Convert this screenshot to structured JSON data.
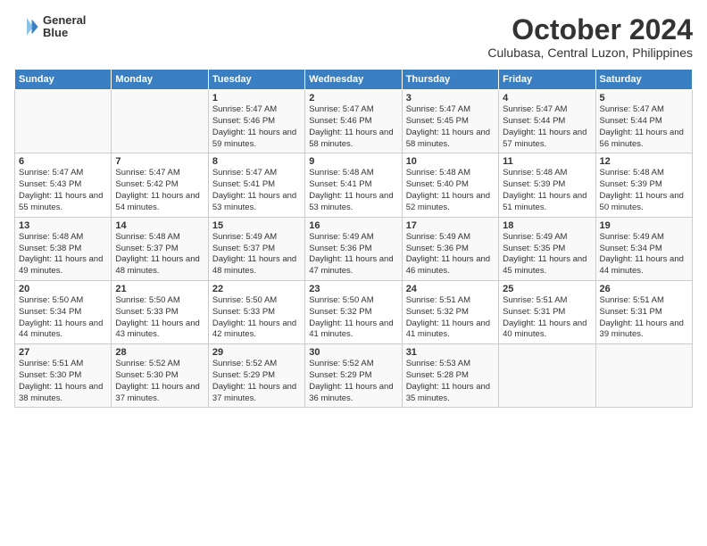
{
  "logo": {
    "line1": "General",
    "line2": "Blue"
  },
  "title": "October 2024",
  "subtitle": "Culubasa, Central Luzon, Philippines",
  "days_of_week": [
    "Sunday",
    "Monday",
    "Tuesday",
    "Wednesday",
    "Thursday",
    "Friday",
    "Saturday"
  ],
  "weeks": [
    [
      {
        "num": "",
        "sunrise": "",
        "sunset": "",
        "daylight": ""
      },
      {
        "num": "",
        "sunrise": "",
        "sunset": "",
        "daylight": ""
      },
      {
        "num": "1",
        "sunrise": "Sunrise: 5:47 AM",
        "sunset": "Sunset: 5:46 PM",
        "daylight": "Daylight: 11 hours and 59 minutes."
      },
      {
        "num": "2",
        "sunrise": "Sunrise: 5:47 AM",
        "sunset": "Sunset: 5:46 PM",
        "daylight": "Daylight: 11 hours and 58 minutes."
      },
      {
        "num": "3",
        "sunrise": "Sunrise: 5:47 AM",
        "sunset": "Sunset: 5:45 PM",
        "daylight": "Daylight: 11 hours and 58 minutes."
      },
      {
        "num": "4",
        "sunrise": "Sunrise: 5:47 AM",
        "sunset": "Sunset: 5:44 PM",
        "daylight": "Daylight: 11 hours and 57 minutes."
      },
      {
        "num": "5",
        "sunrise": "Sunrise: 5:47 AM",
        "sunset": "Sunset: 5:44 PM",
        "daylight": "Daylight: 11 hours and 56 minutes."
      }
    ],
    [
      {
        "num": "6",
        "sunrise": "Sunrise: 5:47 AM",
        "sunset": "Sunset: 5:43 PM",
        "daylight": "Daylight: 11 hours and 55 minutes."
      },
      {
        "num": "7",
        "sunrise": "Sunrise: 5:47 AM",
        "sunset": "Sunset: 5:42 PM",
        "daylight": "Daylight: 11 hours and 54 minutes."
      },
      {
        "num": "8",
        "sunrise": "Sunrise: 5:47 AM",
        "sunset": "Sunset: 5:41 PM",
        "daylight": "Daylight: 11 hours and 53 minutes."
      },
      {
        "num": "9",
        "sunrise": "Sunrise: 5:48 AM",
        "sunset": "Sunset: 5:41 PM",
        "daylight": "Daylight: 11 hours and 53 minutes."
      },
      {
        "num": "10",
        "sunrise": "Sunrise: 5:48 AM",
        "sunset": "Sunset: 5:40 PM",
        "daylight": "Daylight: 11 hours and 52 minutes."
      },
      {
        "num": "11",
        "sunrise": "Sunrise: 5:48 AM",
        "sunset": "Sunset: 5:39 PM",
        "daylight": "Daylight: 11 hours and 51 minutes."
      },
      {
        "num": "12",
        "sunrise": "Sunrise: 5:48 AM",
        "sunset": "Sunset: 5:39 PM",
        "daylight": "Daylight: 11 hours and 50 minutes."
      }
    ],
    [
      {
        "num": "13",
        "sunrise": "Sunrise: 5:48 AM",
        "sunset": "Sunset: 5:38 PM",
        "daylight": "Daylight: 11 hours and 49 minutes."
      },
      {
        "num": "14",
        "sunrise": "Sunrise: 5:48 AM",
        "sunset": "Sunset: 5:37 PM",
        "daylight": "Daylight: 11 hours and 48 minutes."
      },
      {
        "num": "15",
        "sunrise": "Sunrise: 5:49 AM",
        "sunset": "Sunset: 5:37 PM",
        "daylight": "Daylight: 11 hours and 48 minutes."
      },
      {
        "num": "16",
        "sunrise": "Sunrise: 5:49 AM",
        "sunset": "Sunset: 5:36 PM",
        "daylight": "Daylight: 11 hours and 47 minutes."
      },
      {
        "num": "17",
        "sunrise": "Sunrise: 5:49 AM",
        "sunset": "Sunset: 5:36 PM",
        "daylight": "Daylight: 11 hours and 46 minutes."
      },
      {
        "num": "18",
        "sunrise": "Sunrise: 5:49 AM",
        "sunset": "Sunset: 5:35 PM",
        "daylight": "Daylight: 11 hours and 45 minutes."
      },
      {
        "num": "19",
        "sunrise": "Sunrise: 5:49 AM",
        "sunset": "Sunset: 5:34 PM",
        "daylight": "Daylight: 11 hours and 44 minutes."
      }
    ],
    [
      {
        "num": "20",
        "sunrise": "Sunrise: 5:50 AM",
        "sunset": "Sunset: 5:34 PM",
        "daylight": "Daylight: 11 hours and 44 minutes."
      },
      {
        "num": "21",
        "sunrise": "Sunrise: 5:50 AM",
        "sunset": "Sunset: 5:33 PM",
        "daylight": "Daylight: 11 hours and 43 minutes."
      },
      {
        "num": "22",
        "sunrise": "Sunrise: 5:50 AM",
        "sunset": "Sunset: 5:33 PM",
        "daylight": "Daylight: 11 hours and 42 minutes."
      },
      {
        "num": "23",
        "sunrise": "Sunrise: 5:50 AM",
        "sunset": "Sunset: 5:32 PM",
        "daylight": "Daylight: 11 hours and 41 minutes."
      },
      {
        "num": "24",
        "sunrise": "Sunrise: 5:51 AM",
        "sunset": "Sunset: 5:32 PM",
        "daylight": "Daylight: 11 hours and 41 minutes."
      },
      {
        "num": "25",
        "sunrise": "Sunrise: 5:51 AM",
        "sunset": "Sunset: 5:31 PM",
        "daylight": "Daylight: 11 hours and 40 minutes."
      },
      {
        "num": "26",
        "sunrise": "Sunrise: 5:51 AM",
        "sunset": "Sunset: 5:31 PM",
        "daylight": "Daylight: 11 hours and 39 minutes."
      }
    ],
    [
      {
        "num": "27",
        "sunrise": "Sunrise: 5:51 AM",
        "sunset": "Sunset: 5:30 PM",
        "daylight": "Daylight: 11 hours and 38 minutes."
      },
      {
        "num": "28",
        "sunrise": "Sunrise: 5:52 AM",
        "sunset": "Sunset: 5:30 PM",
        "daylight": "Daylight: 11 hours and 37 minutes."
      },
      {
        "num": "29",
        "sunrise": "Sunrise: 5:52 AM",
        "sunset": "Sunset: 5:29 PM",
        "daylight": "Daylight: 11 hours and 37 minutes."
      },
      {
        "num": "30",
        "sunrise": "Sunrise: 5:52 AM",
        "sunset": "Sunset: 5:29 PM",
        "daylight": "Daylight: 11 hours and 36 minutes."
      },
      {
        "num": "31",
        "sunrise": "Sunrise: 5:53 AM",
        "sunset": "Sunset: 5:28 PM",
        "daylight": "Daylight: 11 hours and 35 minutes."
      },
      {
        "num": "",
        "sunrise": "",
        "sunset": "",
        "daylight": ""
      },
      {
        "num": "",
        "sunrise": "",
        "sunset": "",
        "daylight": ""
      }
    ]
  ]
}
